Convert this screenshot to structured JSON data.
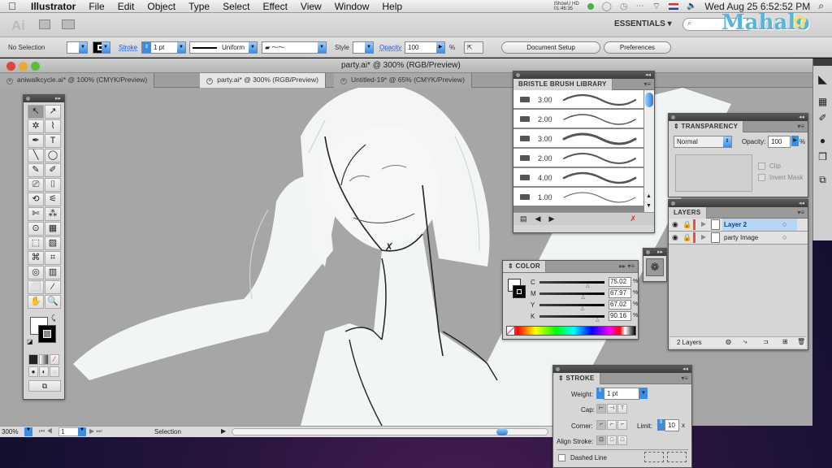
{
  "menubar": {
    "apple": "",
    "app_name": "Illustrator",
    "items": [
      "File",
      "Edit",
      "Object",
      "Type",
      "Select",
      "Effect",
      "View",
      "Window",
      "Help"
    ],
    "ishowu_label": "iShowU HD",
    "ishowu_time": "01:46:35",
    "clock": "Wed Aug 25  6:52:52 PM"
  },
  "appbar": {
    "ai_logo": "Ai",
    "workspace": "ESSENTIALS ▾",
    "search_placeholder": "⌕",
    "watermark": "Mahalo"
  },
  "control_bar": {
    "selection": "No Selection",
    "stroke_label": "Stroke",
    "stroke_weight": "1 pt",
    "profile": "Uniform",
    "style_label": "Style",
    "opacity_label": "Opacity",
    "opacity_value": "100",
    "opacity_unit": "%",
    "document_setup": "Document Setup",
    "preferences": "Preferences"
  },
  "window": {
    "title": "party.ai* @ 300% (RGB/Preview)",
    "tabs": [
      {
        "label": "aniwalkcycle.ai* @ 100% (CMYK/Preview)",
        "active": false
      },
      {
        "label": "party.ai* @ 300% (RGB/Preview)",
        "active": true
      },
      {
        "label": "Untitled-19* @ 65% (CMYK/Preview)",
        "active": false
      }
    ]
  },
  "statusbar": {
    "zoom": "300%",
    "page": "1",
    "tool": "Selection"
  },
  "tools": [
    "↖",
    "↗",
    "✲",
    "⌇",
    "✒",
    "T",
    "╲",
    "◯",
    "✎",
    "✐",
    "⎚",
    "⌷",
    "⟲",
    "⚟",
    "✄",
    "⁂",
    "⊙",
    "▦",
    "⬚",
    "▨",
    "⌘",
    "⌗",
    "◎",
    "▥",
    "⬜",
    "⁄",
    "✋",
    "🔍"
  ],
  "brush_library": {
    "title": "BRISTLE BRUSH LIBRARY",
    "brushes": [
      "3.00",
      "2.00",
      "3.00",
      "2.00",
      "4.00",
      "1.00"
    ]
  },
  "color": {
    "title": "COLOR",
    "channels": [
      {
        "label": "C",
        "value": "75.02",
        "unit": "%",
        "fraction": 0.7502
      },
      {
        "label": "M",
        "value": "67.97",
        "unit": "%",
        "fraction": 0.6797
      },
      {
        "label": "Y",
        "value": "67.02",
        "unit": "%",
        "fraction": 0.6702
      },
      {
        "label": "K",
        "value": "90.16",
        "unit": "%",
        "fraction": 0.9016
      }
    ]
  },
  "transparency": {
    "title": "TRANSPARENCY",
    "blend_mode": "Normal",
    "opacity_label": "Opacity:",
    "opacity_value": "100",
    "opacity_unit": "%",
    "clip_label": "Clip",
    "invert_mask_label": "Invert Mask"
  },
  "layers": {
    "title": "LAYERS",
    "items": [
      {
        "name": "Layer 2",
        "selected": true
      },
      {
        "name": "party Image",
        "selected": false
      }
    ],
    "count": "2 Layers"
  },
  "stroke": {
    "title": "STROKE",
    "weight_label": "Weight:",
    "weight_value": "1 pt",
    "cap_label": "Cap:",
    "corner_label": "Corner:",
    "limit_label": "Limit:",
    "limit_value": "10",
    "limit_unit": "x",
    "align_label": "Align Stroke:",
    "dashed_label": "Dashed Line"
  },
  "colors": {
    "accent": "#3a8de0",
    "layer_color": "#e05050",
    "canvas_bg": "#a6a6a6"
  }
}
